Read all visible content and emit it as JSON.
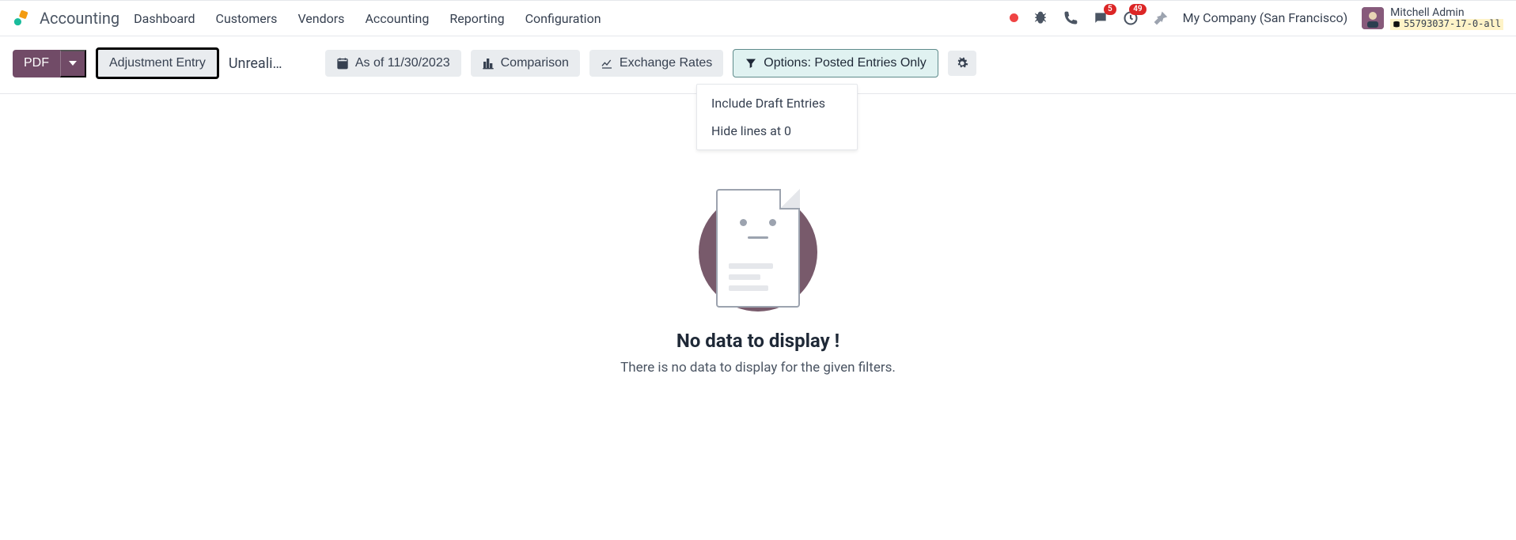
{
  "header": {
    "app_name": "Accounting",
    "nav": [
      "Dashboard",
      "Customers",
      "Vendors",
      "Accounting",
      "Reporting",
      "Configuration"
    ],
    "badge_messages": "5",
    "badge_activities": "49",
    "company": "My Company (San Francisco)",
    "user_name": "Mitchell Admin",
    "db_name": "55793037-17-0-all"
  },
  "toolbar": {
    "pdf_label": "PDF",
    "adjustment_label": "Adjustment Entry",
    "truncated_label": "Unrealized",
    "asof_label": "As of 11/30/2023",
    "comparison_label": "Comparison",
    "exchange_label": "Exchange Rates",
    "options_label": "Options: Posted Entries Only",
    "dropdown": {
      "include_draft": "Include Draft Entries",
      "hide_zero": "Hide lines at 0"
    }
  },
  "empty": {
    "title": "No data to display !",
    "subtitle": "There is no data to display for the given filters."
  }
}
